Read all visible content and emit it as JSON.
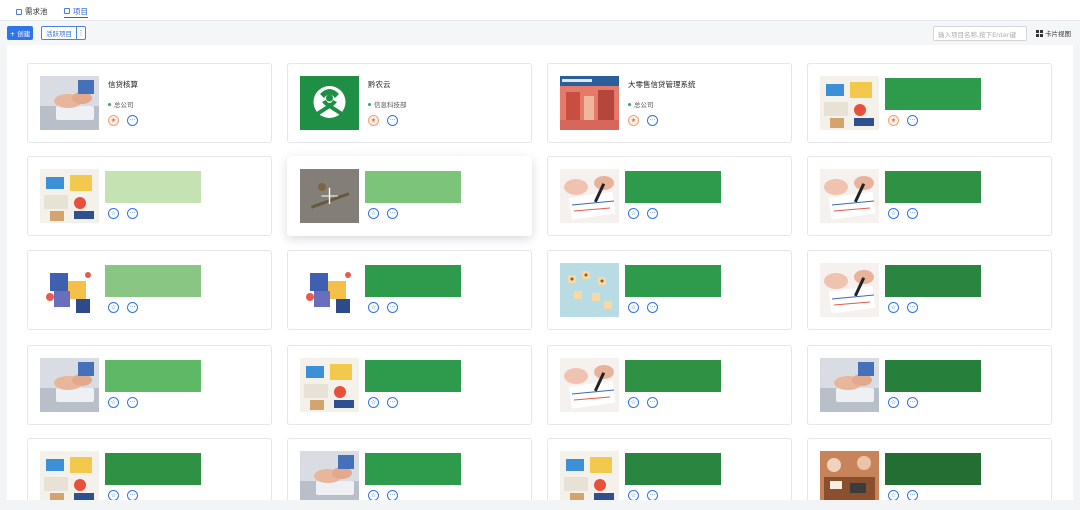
{
  "tabs": [
    {
      "label": "需求池",
      "active": false
    },
    {
      "label": "项目",
      "active": true
    }
  ],
  "toolbar": {
    "create_label": "+ 创建",
    "filter_label": "活跃项目",
    "filter_more": "⋮",
    "search_placeholder": "输入项目名称,按下Enter键",
    "view_label": "卡片视图"
  },
  "colors": {
    "accent": "#2f74e8",
    "mask": "#2e9a4c",
    "star": "#ee6a3a"
  },
  "cards": [
    {
      "name": "信贷核算",
      "org": "总公司",
      "thumb": "hands",
      "starred": true
    },
    {
      "name": "黔农云",
      "org": "信息科技部",
      "thumb": "logo",
      "starred": true
    },
    {
      "name": "大零售信贷管理系统",
      "org": "总公司",
      "thumb": "banner",
      "starred": true
    },
    {
      "name": "",
      "org": "",
      "thumb": "desk",
      "starred": true,
      "mask": "#2e9a4c"
    },
    {
      "name": "",
      "org": "",
      "thumb": "desk",
      "mask": "#c5e2b3"
    },
    {
      "name": "",
      "org": "",
      "thumb": "pen",
      "hover": true,
      "mask": "#7cc47a"
    },
    {
      "name": "",
      "org": "",
      "thumb": "write",
      "mask": "#2e9a4c"
    },
    {
      "name": "",
      "org": "",
      "thumb": "write",
      "mask": "#2e9144"
    },
    {
      "name": "",
      "org": "",
      "thumb": "puzzle",
      "mask": "#8ac683"
    },
    {
      "name": "",
      "org": "",
      "thumb": "puzzle",
      "mask": "#2e9a4c"
    },
    {
      "name": "",
      "org": "",
      "thumb": "blocks",
      "mask": "#2e9a4c"
    },
    {
      "name": "",
      "org": "",
      "thumb": "write",
      "mask": "#2a8540"
    },
    {
      "name": "",
      "org": "",
      "thumb": "hands",
      "mask": "#5fb866"
    },
    {
      "name": "",
      "org": "",
      "thumb": "desk",
      "mask": "#2e9a4c"
    },
    {
      "name": "",
      "org": "",
      "thumb": "write",
      "mask": "#2e9144"
    },
    {
      "name": "",
      "org": "",
      "thumb": "hands",
      "mask": "#277f3c"
    },
    {
      "name": "",
      "org": "",
      "thumb": "desk",
      "mask": "#2e9144"
    },
    {
      "name": "",
      "org": "",
      "thumb": "hands",
      "mask": "#2e9a4c"
    },
    {
      "name": "",
      "org": "",
      "thumb": "desk",
      "mask": "#2a8540"
    },
    {
      "name": "",
      "org": "",
      "thumb": "office",
      "mask": "#246e34"
    }
  ]
}
